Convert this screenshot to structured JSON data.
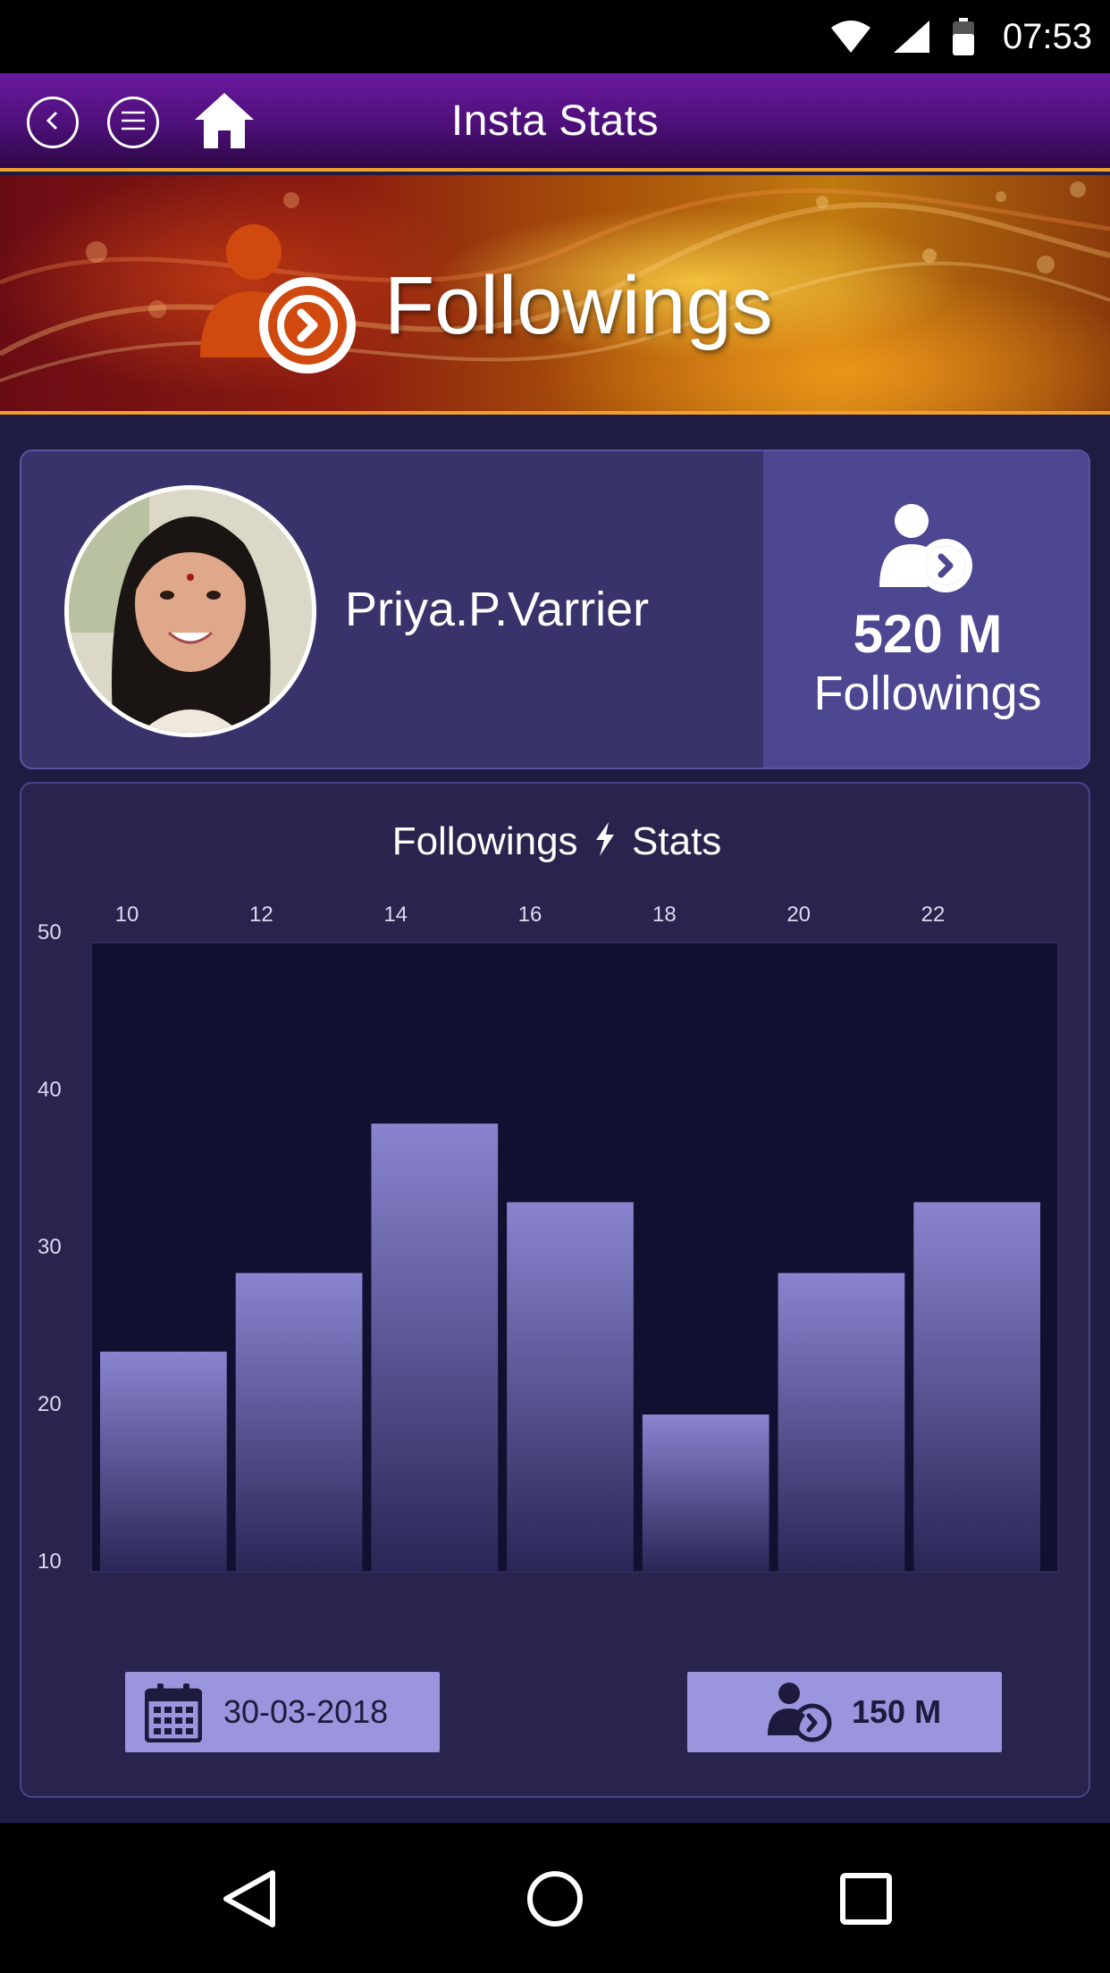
{
  "status_bar": {
    "time": "07:53",
    "icons": [
      "wifi-icon",
      "signal-icon",
      "battery-icon"
    ]
  },
  "header": {
    "title": "Insta Stats",
    "buttons": [
      "back-icon",
      "menu-icon",
      "home-icon"
    ]
  },
  "banner": {
    "title": "Followings",
    "icon": "following-user-icon"
  },
  "profile": {
    "name": "Priya.P.Varrier",
    "stat_value": "520 M",
    "stat_label": "Followings"
  },
  "chart_card": {
    "title_left": "Followings",
    "title_right": "Stats"
  },
  "footer": {
    "date": "30-03-2018",
    "count": "150 M"
  },
  "colors": {
    "accent": "#9a95dc",
    "bar_top": "#8a84d0",
    "bar_bottom": "#2a2656",
    "plot_bg": "#121030",
    "header": "#5a1488"
  },
  "chart_data": {
    "type": "bar",
    "categories": [
      "10",
      "12",
      "14",
      "16",
      "18",
      "20",
      "22"
    ],
    "values": [
      24,
      29,
      38.5,
      33.5,
      20,
      29,
      33.5
    ],
    "yticks": [
      "50",
      "40",
      "30",
      "20",
      "10"
    ],
    "ylim": [
      10,
      50
    ],
    "grid": false
  }
}
